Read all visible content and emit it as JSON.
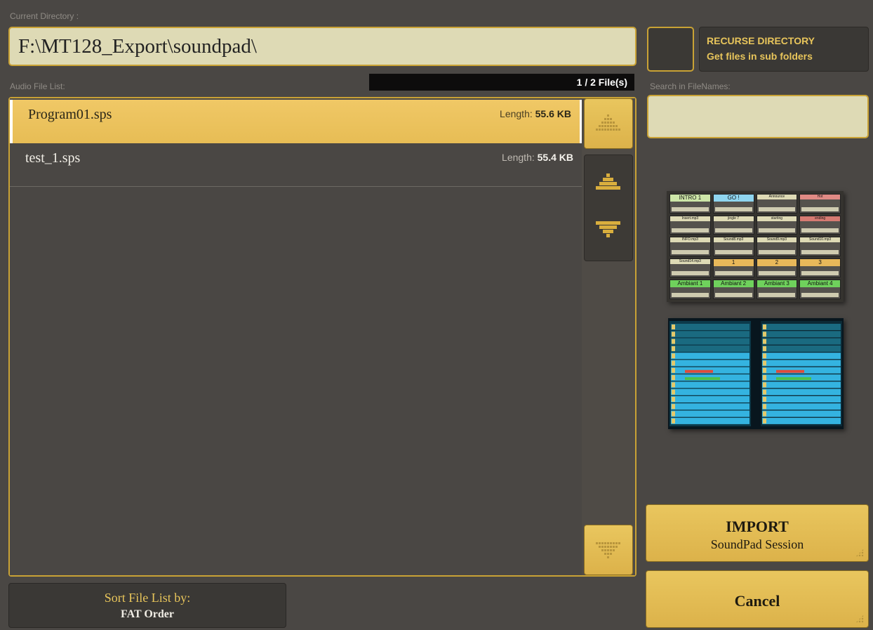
{
  "labels": {
    "current_directory": "Current Directory :",
    "audio_file_list": "Audio File List:",
    "search_in_filenames": "Search in FileNames:"
  },
  "directory": {
    "path": "F:\\MT128_Export\\soundpad\\"
  },
  "file_count": "1 / 2 File(s)",
  "files": [
    {
      "name": "Program01.sps",
      "length_label": "Length:",
      "length_value": "55.6 KB",
      "selected": true
    },
    {
      "name": "test_1.sps",
      "length_label": "Length:",
      "length_value": "55.4 KB",
      "selected": false
    }
  ],
  "recurse": {
    "title": "RECURSE DIRECTORY",
    "subtitle": "Get files in sub folders"
  },
  "search": {
    "value": ""
  },
  "import_button": {
    "title": "IMPORT",
    "subtitle": "SoundPad Session"
  },
  "cancel_button": {
    "label": "Cancel"
  },
  "sort_button": {
    "title": "Sort File List by:",
    "value": "FAT Order"
  },
  "thumbnail1": {
    "rows": [
      [
        {
          "t": "INTRO 1",
          "c": "#cde6a8"
        },
        {
          "t": "GO !",
          "c": "#8fd5ef"
        },
        {
          "t": "Announce",
          "c": "#dedab5"
        },
        {
          "t": "Hot",
          "c": "#e08a84"
        }
      ],
      [
        {
          "t": "Insert.mp3",
          "c": "#dedab5"
        },
        {
          "t": "jingle 7",
          "c": "#dedab5"
        },
        {
          "t": "starting",
          "c": "#dedab5"
        },
        {
          "t": "ending",
          "c": "#d67a72"
        }
      ],
      [
        {
          "t": "INFO.mp3",
          "c": "#dedab5"
        },
        {
          "t": "Sound8.mp3",
          "c": "#dedab5"
        },
        {
          "t": "Sound9.mp3",
          "c": "#dedab5"
        },
        {
          "t": "Sound10.mp3",
          "c": "#dedab5"
        }
      ],
      [
        {
          "t": "Sound14.mp3",
          "c": "#dedab5"
        },
        {
          "t": "1",
          "c": "#e8b85a"
        },
        {
          "t": "2",
          "c": "#e8b85a"
        },
        {
          "t": "3",
          "c": "#e8b85a"
        }
      ],
      [
        {
          "t": "Ambiant 1",
          "c": "#6fd15c"
        },
        {
          "t": "Ambiant 2",
          "c": "#6fd15c"
        },
        {
          "t": "Ambiant 3",
          "c": "#6fd15c"
        },
        {
          "t": "Ambiant 4",
          "c": "#6fd15c"
        }
      ]
    ]
  }
}
